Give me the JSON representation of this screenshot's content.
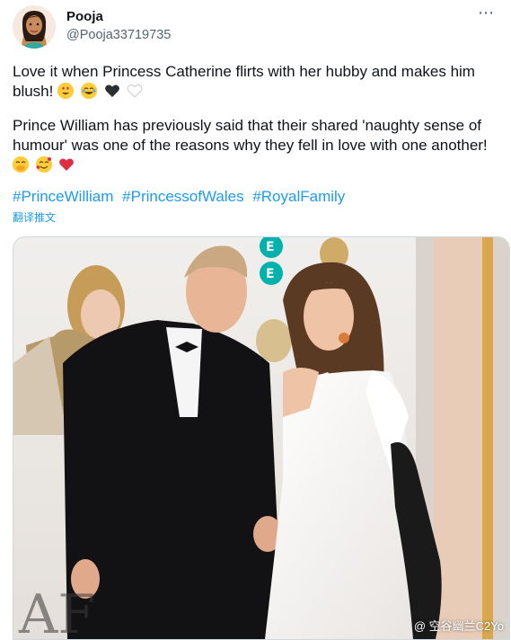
{
  "user": {
    "name": "Pooja",
    "handle": "@Pooja33719735"
  },
  "tweet": {
    "line1": "Love it when Princess Catherine flirts with her hubby and makes him",
    "line2": "blush!",
    "line3": "Prince William has previously said that their shared 'naughty sense of",
    "line4": "humour' was one of the reasons why they fell in love with one another!",
    "hashtags": [
      "#PrinceWilliam",
      "#PrincessofWales",
      "#RoyalFamily"
    ],
    "translate_label": "翻译推文"
  },
  "photo": {
    "sign_text": "EE",
    "floor_text": "AF"
  },
  "watermark": "@ 空谷幽兰C2Yo",
  "icons": {
    "more": "more-options-icon",
    "emoji_set_1": [
      "heart-eyes-emoji",
      "tears-of-joy-emoji",
      "black-heart-emoji",
      "white-heart-emoji"
    ],
    "emoji_set_2": [
      "hand-over-mouth-emoji",
      "smiling-face-with-hearts-emoji",
      "red-heart-emoji"
    ]
  },
  "colors": {
    "link": "#1d9bf0",
    "secondary_text": "#536471",
    "text": "#0f1419"
  }
}
